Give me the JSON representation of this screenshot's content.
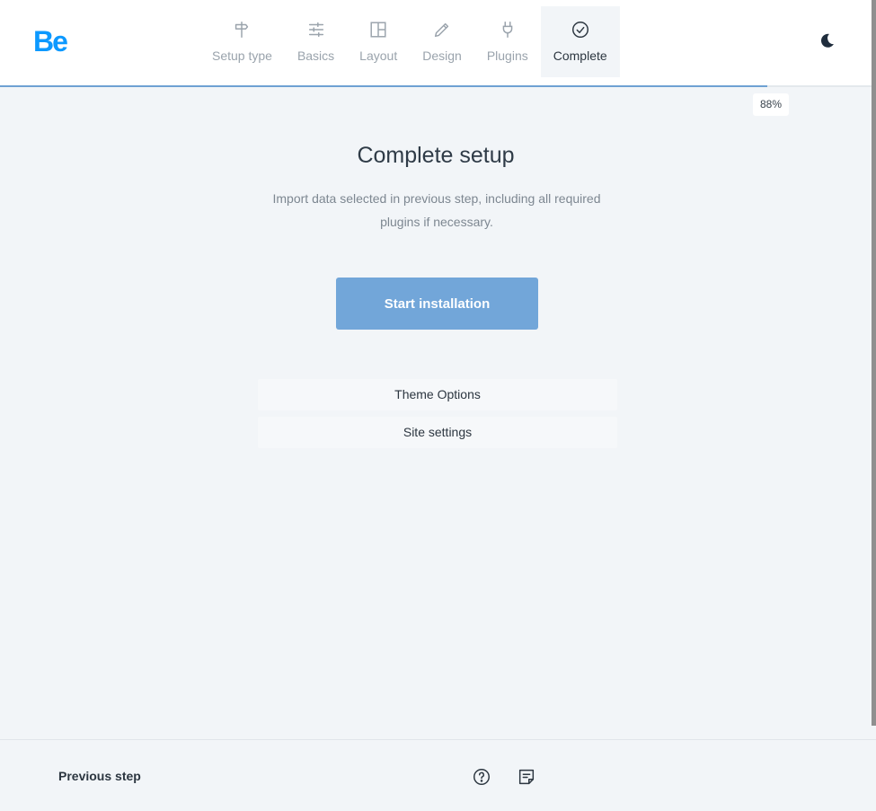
{
  "header": {
    "logo": "Be",
    "steps": [
      {
        "label": "Setup type",
        "icon": "signpost-icon",
        "active": false
      },
      {
        "label": "Basics",
        "icon": "sliders-icon",
        "active": false
      },
      {
        "label": "Layout",
        "icon": "layout-icon",
        "active": false
      },
      {
        "label": "Design",
        "icon": "pencil-icon",
        "active": false
      },
      {
        "label": "Plugins",
        "icon": "plug-icon",
        "active": false
      },
      {
        "label": "Complete",
        "icon": "check-circle-icon",
        "active": true
      }
    ],
    "theme_toggle_icon": "moon-icon"
  },
  "progress": {
    "percent": 88,
    "label": "88%"
  },
  "main": {
    "title": "Complete setup",
    "description": "Import data selected in previous step, including all required plugins if necessary.",
    "start_button": "Start installation",
    "options": [
      "Theme Options",
      "Site settings"
    ]
  },
  "footer": {
    "previous_step": "Previous step",
    "help_icon": "help-circle-icon",
    "notes_icon": "notes-icon"
  },
  "colors": {
    "accent": "#0d99ff",
    "button": "#72a6d9",
    "progress": "#6ea1d3",
    "background": "#f2f5f8"
  }
}
